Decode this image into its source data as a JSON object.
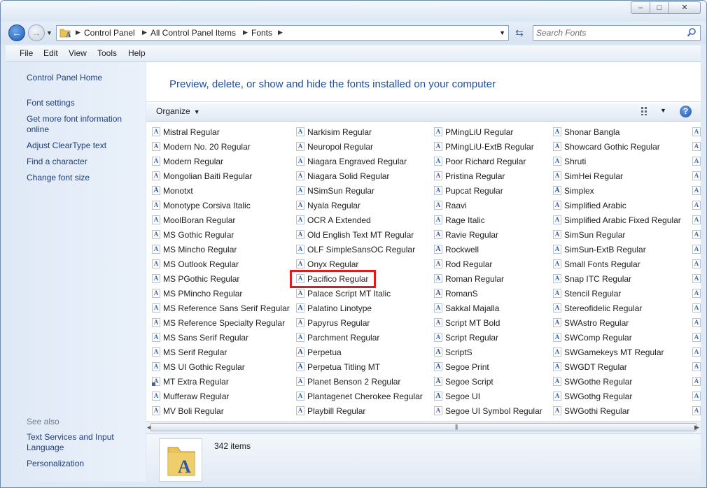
{
  "window": {
    "min_glyph": "–",
    "max_glyph": "□",
    "close_glyph": "✕"
  },
  "nav": {
    "back_glyph": "←",
    "forward_glyph": "→",
    "breadcrumb": [
      "Control Panel",
      "All Control Panel Items",
      "Fonts"
    ],
    "search_placeholder": "Search Fonts"
  },
  "menu": [
    "File",
    "Edit",
    "View",
    "Tools",
    "Help"
  ],
  "sidebar": {
    "links": [
      "Control Panel Home",
      "Font settings",
      "Get more font information online",
      "Adjust ClearType text",
      "Find a character",
      "Change font size"
    ],
    "see_also_label": "See also",
    "see_also": [
      "Text Services and Input Language",
      "Personalization"
    ]
  },
  "main": {
    "headline": "Preview, delete, or show and hide the fonts installed on your computer",
    "organize_label": "Organize",
    "help_glyph": "?"
  },
  "font_columns": [
    [
      "Mistral Regular",
      "Modern No. 20 Regular",
      "Modern Regular",
      "Mongolian Baiti Regular",
      "Monotxt",
      "Monotype Corsiva Italic",
      "MoolBoran Regular",
      "MS Gothic Regular",
      "MS Mincho Regular",
      "MS Outlook Regular",
      "MS PGothic Regular",
      "MS PMincho Regular",
      "MS Reference Sans Serif Regular",
      "MS Reference Specialty Regular",
      "MS Sans Serif Regular",
      "MS Serif Regular",
      "MS UI Gothic Regular",
      "MT Extra Regular",
      "Mufferaw Regular",
      "MV Boli Regular"
    ],
    [
      "Narkisim Regular",
      "Neuropol Regular",
      "Niagara Engraved Regular",
      "Niagara Solid Regular",
      "NSimSun Regular",
      "Nyala Regular",
      "OCR A Extended",
      "Old English Text MT Regular",
      "OLF SimpleSansOC Regular",
      "Onyx Regular",
      "Pacifico Regular",
      "Palace Script MT Italic",
      "Palatino Linotype",
      "Papyrus Regular",
      "Parchment Regular",
      "Perpetua",
      "Perpetua Titling MT",
      "Planet Benson 2 Regular",
      "Plantagenet Cherokee Regular",
      "Playbill Regular"
    ],
    [
      "PMingLiU Regular",
      "PMingLiU-ExtB Regular",
      "Poor Richard Regular",
      "Pristina Regular",
      "Pupcat Regular",
      "Raavi",
      "Rage Italic",
      "Ravie Regular",
      "Rockwell",
      "Rod Regular",
      "Roman Regular",
      "RomanS",
      "Sakkal Majalla",
      "Script MT Bold",
      "Script Regular",
      "ScriptS",
      "Segoe Print",
      "Segoe Script",
      "Segoe UI",
      "Segoe UI Symbol Regular"
    ],
    [
      "Shonar Bangla",
      "Showcard Gothic Regular",
      "Shruti",
      "SimHei Regular",
      "Simplex",
      "Simplified Arabic",
      "Simplified Arabic Fixed Regular",
      "SimSun Regular",
      "SimSun-ExtB Regular",
      "Small Fonts Regular",
      "Snap ITC Regular",
      "Stencil Regular",
      "Stereofidelic Regular",
      "SWAstro Regular",
      "SWComp Regular",
      "SWGamekeys MT Regular",
      "SWGDT Regular",
      "SWGothe Regular",
      "SWGothg Regular",
      "SWGothi Regular"
    ]
  ],
  "selected_font": "Pacifico Regular",
  "status": {
    "item_count": "342 items"
  }
}
